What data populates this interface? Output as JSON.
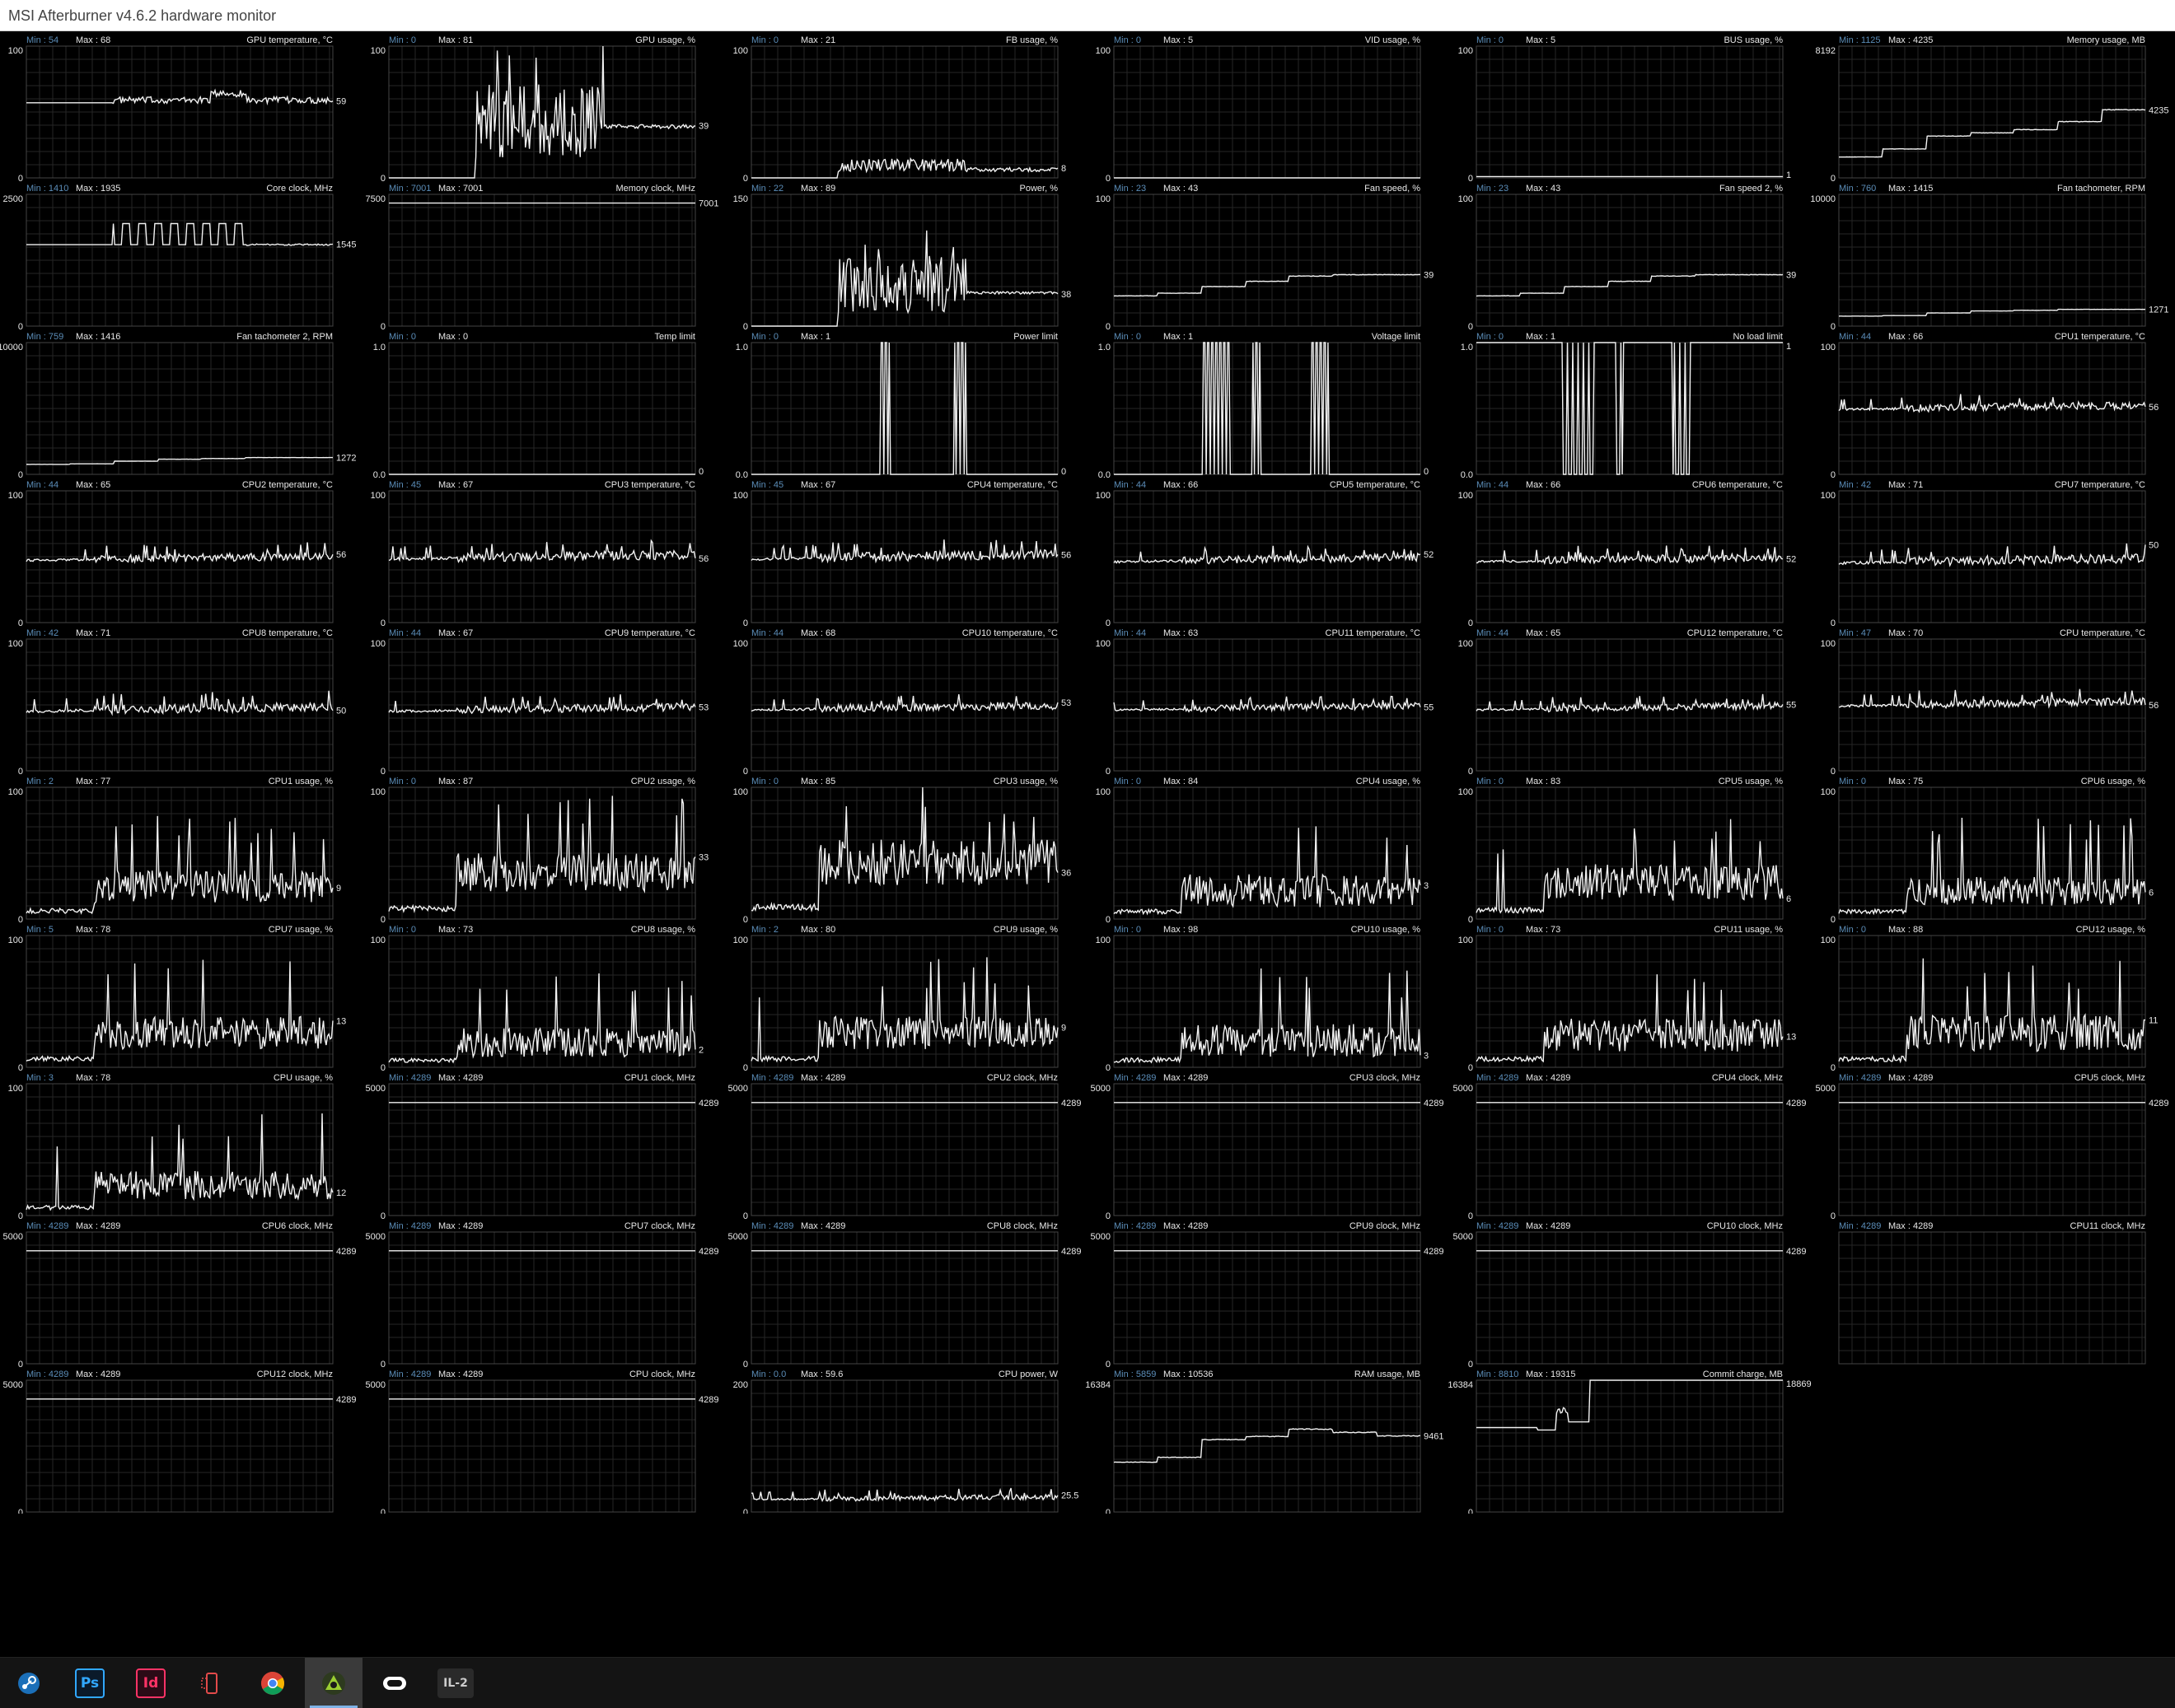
{
  "window": {
    "title": "MSI Afterburner v4.6.2 hardware monitor"
  },
  "graphs": [
    {
      "name": "GPU temperature, °C",
      "min_label": "Min : 54",
      "max_label": "Max : 68",
      "scale_top": "100",
      "scale_bottom": "0",
      "current": "59",
      "ymax": 100,
      "shape": "wander",
      "level": 59,
      "amp": 5
    },
    {
      "name": "GPU usage, %",
      "min_label": "Min : 0",
      "max_label": "Max : 81",
      "scale_top": "100",
      "scale_bottom": "0",
      "current": "39",
      "ymax": 100,
      "shape": "usage-gpu",
      "level": 39,
      "amp": 35
    },
    {
      "name": "FB usage, %",
      "min_label": "Min : 0",
      "max_label": "Max : 21",
      "scale_top": "100",
      "scale_bottom": "0",
      "current": "8",
      "ymax": 100,
      "shape": "spiky",
      "level": 8,
      "amp": 10
    },
    {
      "name": "VID usage, %",
      "min_label": "Min : 0",
      "max_label": "Max : 5",
      "scale_top": "100",
      "scale_bottom": "0",
      "current": "",
      "ymax": 100,
      "shape": "flat",
      "level": 0
    },
    {
      "name": "BUS usage, %",
      "min_label": "Min : 0",
      "max_label": "Max : 5",
      "scale_top": "100",
      "scale_bottom": "0",
      "current": "1",
      "ymax": 100,
      "shape": "flat",
      "level": 1
    },
    {
      "name": "Memory usage, MB",
      "min_label": "Min : 1125",
      "max_label": "Max : 4235",
      "scale_top": "8192",
      "scale_bottom": "0",
      "current": "4235",
      "ymax": 8192,
      "shape": "steps",
      "levels": [
        1300,
        1800,
        2600,
        2800,
        3000,
        3500,
        4235
      ]
    },
    {
      "name": "Core clock, MHz",
      "min_label": "Min : 1410",
      "max_label": "Max : 1935",
      "scale_top": "2500",
      "scale_bottom": "0",
      "current": "1545",
      "ymax": 2500,
      "shape": "square-mid",
      "level": 1545,
      "amp": 400
    },
    {
      "name": "Memory clock, MHz",
      "min_label": "Min : 7001",
      "max_label": "Max : 7001",
      "scale_top": "7500",
      "scale_bottom": "0",
      "current": "7001",
      "ymax": 7500,
      "shape": "flat",
      "level": 7001
    },
    {
      "name": "Power, %",
      "min_label": "Min : 22",
      "max_label": "Max : 89",
      "scale_top": "150",
      "scale_bottom": "0",
      "current": "38",
      "ymax": 150,
      "shape": "usage-gpu",
      "level": 38,
      "amp": 40
    },
    {
      "name": "Fan speed, %",
      "min_label": "Min : 23",
      "max_label": "Max : 43",
      "scale_top": "100",
      "scale_bottom": "0",
      "current": "39",
      "ymax": 100,
      "shape": "steps",
      "levels": [
        23,
        25,
        30,
        34,
        38,
        39,
        39
      ]
    },
    {
      "name": "Fan speed 2, %",
      "min_label": "Min : 23",
      "max_label": "Max : 43",
      "scale_top": "100",
      "scale_bottom": "0",
      "current": "39",
      "ymax": 100,
      "shape": "steps",
      "levels": [
        23,
        25,
        30,
        34,
        38,
        39,
        39
      ]
    },
    {
      "name": "Fan tachometer, RPM",
      "min_label": "Min : 760",
      "max_label": "Max : 1415",
      "scale_top": "10000",
      "scale_bottom": "0",
      "current": "1271",
      "ymax": 10000,
      "shape": "steps",
      "levels": [
        760,
        800,
        1000,
        1150,
        1200,
        1271,
        1271
      ]
    },
    {
      "name": "Fan tachometer 2, RPM",
      "min_label": "Min : 759",
      "max_label": "Max : 1416",
      "scale_top": "10000",
      "scale_bottom": "0",
      "current": "1272",
      "ymax": 10000,
      "shape": "steps",
      "levels": [
        759,
        800,
        1000,
        1150,
        1200,
        1272,
        1272
      ]
    },
    {
      "name": "Temp limit",
      "min_label": "Min : 0",
      "max_label": "Max : 0",
      "scale_top": "1.0",
      "scale_bottom": "0.0",
      "current": "0",
      "ymax": 1,
      "shape": "flat",
      "level": 0
    },
    {
      "name": "Power limit",
      "min_label": "Min : 0",
      "max_label": "Max : 1",
      "scale_top": "1.0",
      "scale_bottom": "0.0",
      "current": "0",
      "ymax": 1,
      "shape": "pulses",
      "pulses": [
        [
          0.42,
          0.45
        ],
        [
          0.66,
          0.7
        ]
      ]
    },
    {
      "name": "Voltage limit",
      "min_label": "Min : 0",
      "max_label": "Max : 1",
      "scale_top": "1.0",
      "scale_bottom": "0.0",
      "current": "0",
      "ymax": 1,
      "shape": "pulses",
      "pulses": [
        [
          0.29,
          0.38
        ],
        [
          0.45,
          0.48
        ],
        [
          0.64,
          0.7
        ]
      ]
    },
    {
      "name": "No load limit",
      "min_label": "Min : 0",
      "max_label": "Max : 1",
      "scale_top": "1.0",
      "scale_bottom": "0.0",
      "current": "1",
      "ymax": 1,
      "shape": "pulses-inv",
      "pulses": [
        [
          0.28,
          0.38
        ],
        [
          0.45,
          0.48
        ],
        [
          0.64,
          0.7
        ]
      ]
    },
    {
      "name": "CPU1 temperature, °C",
      "min_label": "Min : 44",
      "max_label": "Max : 66",
      "scale_top": "100",
      "scale_bottom": "0",
      "current": "56",
      "ymax": 100,
      "shape": "noise",
      "level": 52,
      "amp": 6
    },
    {
      "name": "CPU2 temperature, °C",
      "min_label": "Min : 44",
      "max_label": "Max : 65",
      "scale_top": "100",
      "scale_bottom": "0",
      "current": "56",
      "ymax": 100,
      "shape": "noise",
      "level": 50,
      "amp": 6
    },
    {
      "name": "CPU3 temperature, °C",
      "min_label": "Min : 45",
      "max_label": "Max : 67",
      "scale_top": "100",
      "scale_bottom": "0",
      "current": "56",
      "ymax": 100,
      "shape": "noise",
      "level": 51,
      "amp": 7
    },
    {
      "name": "CPU4 temperature, °C",
      "min_label": "Min : 45",
      "max_label": "Max : 67",
      "scale_top": "100",
      "scale_bottom": "0",
      "current": "56",
      "ymax": 100,
      "shape": "noise",
      "level": 51,
      "amp": 7
    },
    {
      "name": "CPU5 temperature, °C",
      "min_label": "Min : 44",
      "max_label": "Max : 66",
      "scale_top": "100",
      "scale_bottom": "0",
      "current": "52",
      "ymax": 100,
      "shape": "noise",
      "level": 49,
      "amp": 6
    },
    {
      "name": "CPU6 temperature, °C",
      "min_label": "Min : 44",
      "max_label": "Max : 66",
      "scale_top": "100",
      "scale_bottom": "0",
      "current": "52",
      "ymax": 100,
      "shape": "noise",
      "level": 49,
      "amp": 6
    },
    {
      "name": "CPU7 temperature, °C",
      "min_label": "Min : 42",
      "max_label": "Max : 71",
      "scale_top": "100",
      "scale_bottom": "0",
      "current": "50",
      "ymax": 100,
      "shape": "noise",
      "level": 48,
      "amp": 7
    },
    {
      "name": "CPU8 temperature, °C",
      "min_label": "Min : 42",
      "max_label": "Max : 71",
      "scale_top": "100",
      "scale_bottom": "0",
      "current": "50",
      "ymax": 100,
      "shape": "noise",
      "level": 48,
      "amp": 7
    },
    {
      "name": "CPU9 temperature, °C",
      "min_label": "Min : 44",
      "max_label": "Max : 67",
      "scale_top": "100",
      "scale_bottom": "0",
      "current": "53",
      "ymax": 100,
      "shape": "noise",
      "level": 48,
      "amp": 6
    },
    {
      "name": "CPU10 temperature, °C",
      "min_label": "Min : 44",
      "max_label": "Max : 68",
      "scale_top": "100",
      "scale_bottom": "0",
      "current": "53",
      "ymax": 100,
      "shape": "noise",
      "level": 49,
      "amp": 6
    },
    {
      "name": "CPU11 temperature, °C",
      "min_label": "Min : 44",
      "max_label": "Max : 63",
      "scale_top": "100",
      "scale_bottom": "0",
      "current": "55",
      "ymax": 100,
      "shape": "noise",
      "level": 49,
      "amp": 5
    },
    {
      "name": "CPU12 temperature, °C",
      "min_label": "Min : 44",
      "max_label": "Max : 65",
      "scale_top": "100",
      "scale_bottom": "0",
      "current": "55",
      "ymax": 100,
      "shape": "noise",
      "level": 49,
      "amp": 5
    },
    {
      "name": "CPU temperature, °C",
      "min_label": "Min : 47",
      "max_label": "Max : 70",
      "scale_top": "100",
      "scale_bottom": "0",
      "current": "56",
      "ymax": 100,
      "shape": "noise",
      "level": 52,
      "amp": 6
    },
    {
      "name": "CPU1 usage, %",
      "min_label": "Min : 2",
      "max_label": "Max : 77",
      "scale_top": "100",
      "scale_bottom": "0",
      "current": "9",
      "ymax": 100,
      "shape": "cpu",
      "level": 15,
      "amp": 25
    },
    {
      "name": "CPU2 usage, %",
      "min_label": "Min : 0",
      "max_label": "Max : 87",
      "scale_top": "100",
      "scale_bottom": "0",
      "current": "33",
      "ymax": 100,
      "shape": "cpu",
      "level": 30,
      "amp": 30
    },
    {
      "name": "CPU3 usage, %",
      "min_label": "Min : 0",
      "max_label": "Max : 85",
      "scale_top": "100",
      "scale_bottom": "0",
      "current": "36",
      "ymax": 100,
      "shape": "cpu",
      "level": 38,
      "amp": 35
    },
    {
      "name": "CPU4 usage, %",
      "min_label": "Min : 0",
      "max_label": "Max : 84",
      "scale_top": "100",
      "scale_bottom": "0",
      "current": "3",
      "ymax": 100,
      "shape": "cpu",
      "level": 10,
      "amp": 25
    },
    {
      "name": "CPU5 usage, %",
      "min_label": "Min : 0",
      "max_label": "Max : 83",
      "scale_top": "100",
      "scale_bottom": "0",
      "current": "6",
      "ymax": 100,
      "shape": "cpu",
      "level": 18,
      "amp": 28
    },
    {
      "name": "CPU6 usage, %",
      "min_label": "Min : 0",
      "max_label": "Max : 75",
      "scale_top": "100",
      "scale_bottom": "0",
      "current": "6",
      "ymax": 100,
      "shape": "cpu",
      "level": 12,
      "amp": 22
    },
    {
      "name": "CPU7 usage, %",
      "min_label": "Min : 5",
      "max_label": "Max : 78",
      "scale_top": "100",
      "scale_bottom": "0",
      "current": "13",
      "ymax": 100,
      "shape": "cpu",
      "level": 18,
      "amp": 25
    },
    {
      "name": "CPU8 usage, %",
      "min_label": "Min : 0",
      "max_label": "Max : 73",
      "scale_top": "100",
      "scale_bottom": "0",
      "current": "2",
      "ymax": 100,
      "shape": "cpu",
      "level": 8,
      "amp": 22
    },
    {
      "name": "CPU9 usage, %",
      "min_label": "Min : 2",
      "max_label": "Max : 80",
      "scale_top": "100",
      "scale_bottom": "0",
      "current": "9",
      "ymax": 100,
      "shape": "cpu",
      "level": 18,
      "amp": 25
    },
    {
      "name": "CPU10 usage, %",
      "min_label": "Min : 0",
      "max_label": "Max : 98",
      "scale_top": "100",
      "scale_bottom": "0",
      "current": "3",
      "ymax": 100,
      "shape": "cpu",
      "level": 8,
      "amp": 25
    },
    {
      "name": "CPU11 usage, %",
      "min_label": "Min : 0",
      "max_label": "Max : 73",
      "scale_top": "100",
      "scale_bottom": "0",
      "current": "13",
      "ymax": 100,
      "shape": "cpu",
      "level": 15,
      "amp": 25
    },
    {
      "name": "CPU12 usage, %",
      "min_label": "Min : 0",
      "max_label": "Max : 88",
      "scale_top": "100",
      "scale_bottom": "0",
      "current": "11",
      "ymax": 100,
      "shape": "cpu",
      "level": 15,
      "amp": 28
    },
    {
      "name": "CPU usage, %",
      "min_label": "Min : 3",
      "max_label": "Max : 78",
      "scale_top": "100",
      "scale_bottom": "0",
      "current": "12",
      "ymax": 100,
      "shape": "cpu",
      "level": 15,
      "amp": 22
    },
    {
      "name": "CPU1 clock, MHz",
      "min_label": "Min : 4289",
      "max_label": "Max : 4289",
      "scale_top": "5000",
      "scale_bottom": "0",
      "current": "4289",
      "ymax": 5000,
      "shape": "flat",
      "level": 4289
    },
    {
      "name": "CPU2 clock, MHz",
      "min_label": "Min : 4289",
      "max_label": "Max : 4289",
      "scale_top": "5000",
      "scale_bottom": "0",
      "current": "4289",
      "ymax": 5000,
      "shape": "flat",
      "level": 4289
    },
    {
      "name": "CPU3 clock, MHz",
      "min_label": "Min : 4289",
      "max_label": "Max : 4289",
      "scale_top": "5000",
      "scale_bottom": "0",
      "current": "4289",
      "ymax": 5000,
      "shape": "flat",
      "level": 4289
    },
    {
      "name": "CPU4 clock, MHz",
      "min_label": "Min : 4289",
      "max_label": "Max : 4289",
      "scale_top": "5000",
      "scale_bottom": "0",
      "current": "4289",
      "ymax": 5000,
      "shape": "flat",
      "level": 4289
    },
    {
      "name": "CPU5 clock, MHz",
      "min_label": "Min : 4289",
      "max_label": "Max : 4289",
      "scale_top": "5000",
      "scale_bottom": "0",
      "current": "4289",
      "ymax": 5000,
      "shape": "flat",
      "level": 4289
    },
    {
      "name": "CPU6 clock, MHz",
      "min_label": "Min : 4289",
      "max_label": "Max : 4289",
      "scale_top": "5000",
      "scale_bottom": "0",
      "current": "4289",
      "ymax": 5000,
      "shape": "flat",
      "level": 4289
    },
    {
      "name": "CPU7 clock, MHz",
      "min_label": "Min : 4289",
      "max_label": "Max : 4289",
      "scale_top": "5000",
      "scale_bottom": "0",
      "current": "4289",
      "ymax": 5000,
      "shape": "flat",
      "level": 4289
    },
    {
      "name": "CPU8 clock, MHz",
      "min_label": "Min : 4289",
      "max_label": "Max : 4289",
      "scale_top": "5000",
      "scale_bottom": "0",
      "current": "4289",
      "ymax": 5000,
      "shape": "flat",
      "level": 4289
    },
    {
      "name": "CPU9 clock, MHz",
      "min_label": "Min : 4289",
      "max_label": "Max : 4289",
      "scale_top": "5000",
      "scale_bottom": "0",
      "current": "4289",
      "ymax": 5000,
      "shape": "flat",
      "level": 4289
    },
    {
      "name": "CPU10 clock, MHz",
      "min_label": "Min : 4289",
      "max_label": "Max : 4289",
      "scale_top": "5000",
      "scale_bottom": "0",
      "current": "4289",
      "ymax": 5000,
      "shape": "flat",
      "level": 4289
    },
    {
      "name": "CPU11 clock, MHz",
      "min_label": "Min : 4289",
      "max_label": "Max : 4289",
      "scale_top": "",
      "scale_bottom": "",
      "current": "",
      "ymax": 5000,
      "shape": "none"
    },
    {
      "name": "CPU12 clock, MHz",
      "min_label": "Min : 4289",
      "max_label": "Max : 4289",
      "scale_top": "5000",
      "scale_bottom": "0",
      "current": "4289",
      "ymax": 5000,
      "shape": "flat",
      "level": 4289
    },
    {
      "name": "CPU clock, MHz",
      "min_label": "Min : 4289",
      "max_label": "Max : 4289",
      "scale_top": "5000",
      "scale_bottom": "0",
      "current": "4289",
      "ymax": 5000,
      "shape": "flat",
      "level": 4289
    },
    {
      "name": "CPU power, W",
      "min_label": "Min : 0.0",
      "max_label": "Max : 59.6",
      "scale_top": "200",
      "scale_bottom": "0",
      "current": "25.5",
      "ymax": 200,
      "shape": "noise",
      "level": 22,
      "amp": 8
    },
    {
      "name": "RAM usage, MB",
      "min_label": "Min : 5859",
      "max_label": "Max : 10536",
      "scale_top": "16384",
      "scale_bottom": "0",
      "current": "9461",
      "ymax": 16384,
      "shape": "steps",
      "levels": [
        6200,
        6800,
        9000,
        9400,
        10300,
        9900,
        9461
      ]
    },
    {
      "name": "Commit charge, MB",
      "min_label": "Min : 8810",
      "max_label": "Max : 19315",
      "scale_top": "16384",
      "scale_bottom": "0",
      "current": "18869",
      "ymax": 16384,
      "shape": "commit"
    }
  ],
  "taskbar": {
    "apps": [
      {
        "id": "steam",
        "label": "",
        "icon": "steam-icon",
        "color": "#1b6fb8"
      },
      {
        "id": "photoshop",
        "label": "Ps",
        "icon": "photoshop-icon",
        "color": "#31a8ff"
      },
      {
        "id": "indesign",
        "label": "Id",
        "icon": "indesign-icon",
        "color": "#ff3366"
      },
      {
        "id": "phone",
        "label": "",
        "icon": "phone-link-icon",
        "color": "#e24a4a"
      },
      {
        "id": "chrome",
        "label": "",
        "icon": "chrome-icon",
        "color": "#34a853"
      },
      {
        "id": "afterburner",
        "label": "",
        "icon": "afterburner-icon",
        "color": "#9acd32",
        "active": true
      },
      {
        "id": "oculus",
        "label": "",
        "icon": "oculus-icon",
        "color": "#ffffff"
      },
      {
        "id": "il2",
        "label": "IL-2",
        "icon": "il2-icon",
        "color": "#cccccc"
      }
    ]
  }
}
